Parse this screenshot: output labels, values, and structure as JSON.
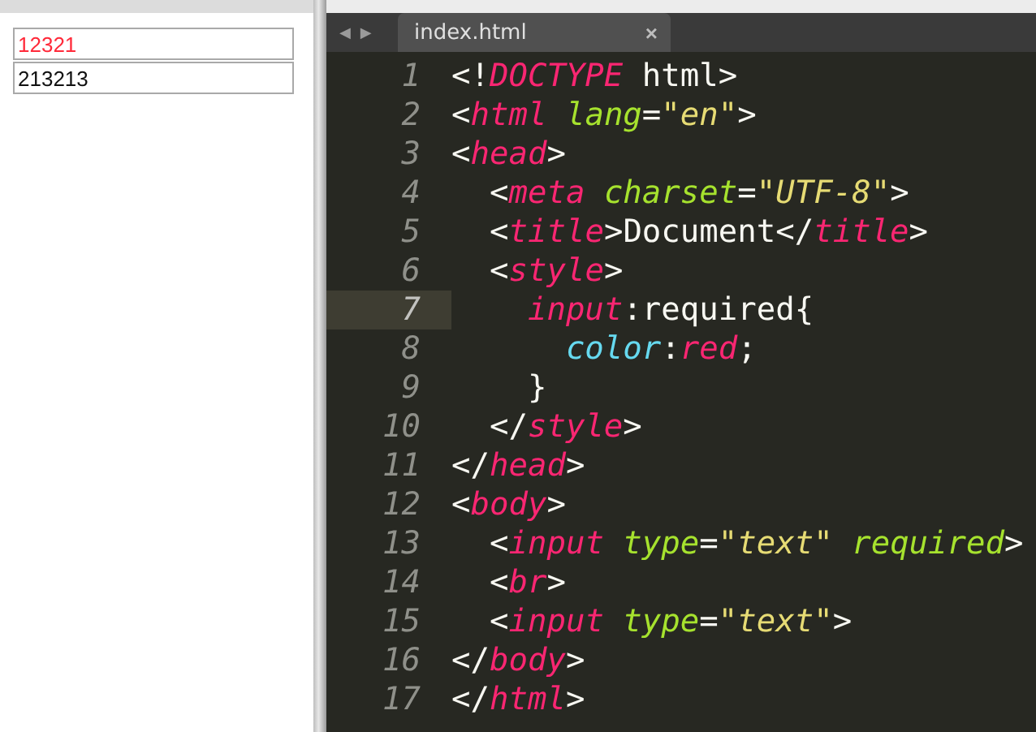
{
  "preview": {
    "inputs": [
      {
        "value": "12321",
        "required": true
      },
      {
        "value": "213213",
        "required": false
      }
    ]
  },
  "editor": {
    "nav": [
      "◀",
      "▶"
    ],
    "tabs": [
      {
        "label": "index.html",
        "close": "×",
        "selected": true
      }
    ],
    "lines": [
      {
        "number": "1",
        "current": false,
        "tokens": [
          {
            "kind": "punct",
            "text": "<!"
          },
          {
            "kind": "tag",
            "text": "DOCTYPE"
          },
          {
            "kind": "plain",
            "text": " html"
          },
          {
            "kind": "punct",
            "text": ">"
          }
        ]
      },
      {
        "number": "2",
        "current": false,
        "tokens": [
          {
            "kind": "punct",
            "text": "<"
          },
          {
            "kind": "tag",
            "text": "html"
          },
          {
            "kind": "attr",
            "text": " lang"
          },
          {
            "kind": "punct",
            "text": "="
          },
          {
            "kind": "string",
            "text": "\"en\""
          },
          {
            "kind": "punct",
            "text": ">"
          }
        ]
      },
      {
        "number": "3",
        "current": false,
        "tokens": [
          {
            "kind": "punct",
            "text": "<"
          },
          {
            "kind": "tag",
            "text": "head"
          },
          {
            "kind": "punct",
            "text": ">"
          }
        ]
      },
      {
        "number": "4",
        "current": false,
        "tokens": [
          {
            "kind": "punct",
            "text": "  <"
          },
          {
            "kind": "tag",
            "text": "meta"
          },
          {
            "kind": "attr",
            "text": " charset"
          },
          {
            "kind": "punct",
            "text": "="
          },
          {
            "kind": "string",
            "text": "\"UTF-8\""
          },
          {
            "kind": "punct",
            "text": ">"
          }
        ]
      },
      {
        "number": "5",
        "current": false,
        "tokens": [
          {
            "kind": "punct",
            "text": "  <"
          },
          {
            "kind": "tag",
            "text": "title"
          },
          {
            "kind": "punct",
            "text": ">"
          },
          {
            "kind": "plain",
            "text": "Document"
          },
          {
            "kind": "punct",
            "text": "</"
          },
          {
            "kind": "tag",
            "text": "title"
          },
          {
            "kind": "punct",
            "text": ">"
          }
        ]
      },
      {
        "number": "6",
        "current": false,
        "tokens": [
          {
            "kind": "punct",
            "text": "  <"
          },
          {
            "kind": "tag",
            "text": "style"
          },
          {
            "kind": "punct",
            "text": ">"
          }
        ]
      },
      {
        "number": "7",
        "current": true,
        "tokens": [
          {
            "kind": "tag",
            "text": "    input"
          },
          {
            "kind": "plain",
            "text": ":required{"
          }
        ]
      },
      {
        "number": "8",
        "current": false,
        "tokens": [
          {
            "kind": "prop",
            "text": "      color"
          },
          {
            "kind": "plain",
            "text": ":"
          },
          {
            "kind": "tag",
            "text": "red"
          },
          {
            "kind": "plain",
            "text": ";"
          }
        ]
      },
      {
        "number": "9",
        "current": false,
        "tokens": [
          {
            "kind": "plain",
            "text": "    }"
          }
        ]
      },
      {
        "number": "10",
        "current": false,
        "tokens": [
          {
            "kind": "punct",
            "text": "  </"
          },
          {
            "kind": "tag",
            "text": "style"
          },
          {
            "kind": "punct",
            "text": ">"
          }
        ]
      },
      {
        "number": "11",
        "current": false,
        "tokens": [
          {
            "kind": "punct",
            "text": "</"
          },
          {
            "kind": "tag",
            "text": "head"
          },
          {
            "kind": "punct",
            "text": ">"
          }
        ]
      },
      {
        "number": "12",
        "current": false,
        "tokens": [
          {
            "kind": "punct",
            "text": "<"
          },
          {
            "kind": "tag",
            "text": "body"
          },
          {
            "kind": "punct",
            "text": ">"
          }
        ]
      },
      {
        "number": "13",
        "current": false,
        "tokens": [
          {
            "kind": "punct",
            "text": "  <"
          },
          {
            "kind": "tag",
            "text": "input"
          },
          {
            "kind": "attr",
            "text": " type"
          },
          {
            "kind": "punct",
            "text": "="
          },
          {
            "kind": "string",
            "text": "\"text\""
          },
          {
            "kind": "attr",
            "text": " required"
          },
          {
            "kind": "punct",
            "text": ">"
          }
        ]
      },
      {
        "number": "14",
        "current": false,
        "tokens": [
          {
            "kind": "punct",
            "text": "  <"
          },
          {
            "kind": "tag",
            "text": "br"
          },
          {
            "kind": "punct",
            "text": ">"
          }
        ]
      },
      {
        "number": "15",
        "current": false,
        "tokens": [
          {
            "kind": "punct",
            "text": "  <"
          },
          {
            "kind": "tag",
            "text": "input"
          },
          {
            "kind": "attr",
            "text": " type"
          },
          {
            "kind": "punct",
            "text": "="
          },
          {
            "kind": "string",
            "text": "\"text\""
          },
          {
            "kind": "punct",
            "text": ">"
          }
        ]
      },
      {
        "number": "16",
        "current": false,
        "tokens": [
          {
            "kind": "punct",
            "text": "</"
          },
          {
            "kind": "tag",
            "text": "body"
          },
          {
            "kind": "punct",
            "text": ">"
          }
        ]
      },
      {
        "number": "17",
        "current": false,
        "tokens": [
          {
            "kind": "punct",
            "text": "</"
          },
          {
            "kind": "tag",
            "text": "html"
          },
          {
            "kind": "punct",
            "text": ">"
          }
        ]
      }
    ]
  }
}
